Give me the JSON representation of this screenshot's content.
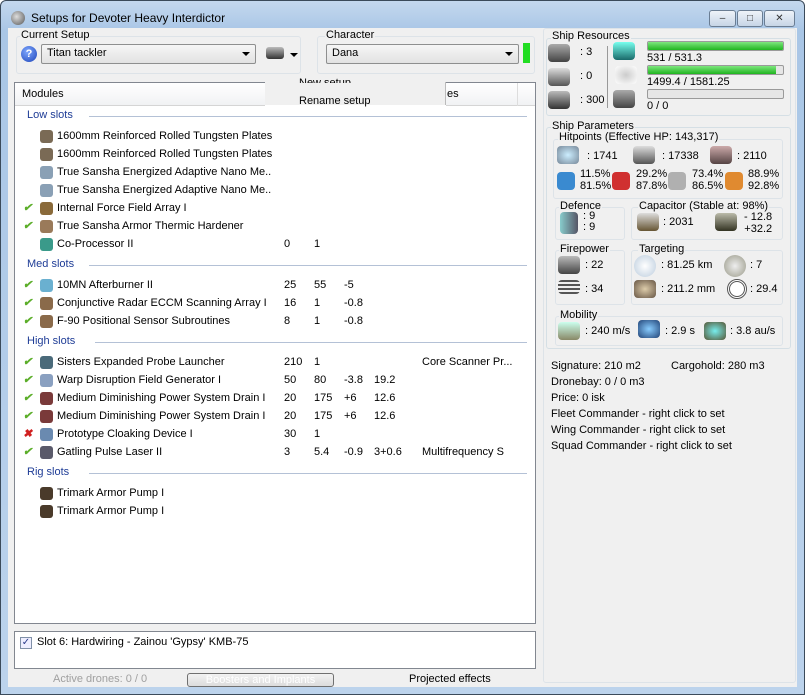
{
  "window": {
    "title": "Setups for Devoter Heavy Interdictor"
  },
  "setup": {
    "label": "Current Setup",
    "value": "Titan tackler"
  },
  "character": {
    "label": "Character",
    "value": "Dana",
    "status_color": "#22dd22"
  },
  "menu": {
    "items": [
      "New setup",
      "Rename setup"
    ]
  },
  "list": {
    "col_modules": "Modules",
    "col_partial": "es",
    "sections": [
      {
        "title": "Low slots",
        "rows": [
          {
            "name": "1600mm Reinforced Rolled Tungsten Plates",
            "state": "",
            "c": [
              "",
              "",
              "",
              "",
              ""
            ],
            "icon": "#7a6a55"
          },
          {
            "name": "1600mm Reinforced Rolled Tungsten Plates",
            "state": "",
            "c": [
              "",
              "",
              "",
              "",
              ""
            ],
            "icon": "#7a6a55"
          },
          {
            "name": "True Sansha Energized Adaptive Nano Me..",
            "state": "",
            "c": [
              "",
              "",
              "",
              "",
              ""
            ],
            "icon": "#8aa0b5"
          },
          {
            "name": "True Sansha Energized Adaptive Nano Me..",
            "state": "",
            "c": [
              "",
              "",
              "",
              "",
              ""
            ],
            "icon": "#8aa0b5"
          },
          {
            "name": "Internal Force Field Array I",
            "state": "ok",
            "c": [
              "",
              "",
              "",
              "",
              ""
            ],
            "icon": "#8a6a3a"
          },
          {
            "name": "True Sansha Armor Thermic Hardener",
            "state": "ok",
            "c": [
              "",
              "",
              "",
              "",
              ""
            ],
            "icon": "#9a7a5a"
          },
          {
            "name": "Co-Processor II",
            "state": "",
            "c": [
              "0",
              "1",
              "",
              "",
              ""
            ],
            "icon": "#3a9a8a"
          }
        ]
      },
      {
        "title": "Med slots",
        "rows": [
          {
            "name": "10MN Afterburner II",
            "state": "ok",
            "c": [
              "25",
              "55",
              "-5",
              "",
              ""
            ],
            "icon": "#6ab0d0"
          },
          {
            "name": "Conjunctive Radar ECCM Scanning Array I",
            "state": "ok",
            "c": [
              "16",
              "1",
              "-0.8",
              "",
              ""
            ],
            "icon": "#8a6a4a"
          },
          {
            "name": "F-90 Positional Sensor Subroutines",
            "state": "ok",
            "c": [
              "8",
              "1",
              "-0.8",
              "",
              ""
            ],
            "icon": "#8a6a4a"
          }
        ]
      },
      {
        "title": "High slots",
        "rows": [
          {
            "name": "Sisters Expanded Probe Launcher",
            "state": "ok",
            "c": [
              "210",
              "1",
              "",
              "",
              "Core Scanner Pr..."
            ],
            "icon": "#4a6a7a"
          },
          {
            "name": "Warp Disruption Field Generator I",
            "state": "ok",
            "c": [
              "50",
              "80",
              "-3.8",
              "19.2",
              ""
            ],
            "icon": "#8aa0c0"
          },
          {
            "name": "Medium Diminishing Power System Drain I",
            "state": "ok",
            "c": [
              "20",
              "175",
              "+6",
              "12.6",
              ""
            ],
            "icon": "#7a3a3a"
          },
          {
            "name": "Medium Diminishing Power System Drain I",
            "state": "ok",
            "c": [
              "20",
              "175",
              "+6",
              "12.6",
              ""
            ],
            "icon": "#7a3a3a"
          },
          {
            "name": "Prototype Cloaking Device I",
            "state": "bad",
            "c": [
              "30",
              "1",
              "",
              "",
              ""
            ],
            "icon": "#6a8ab0"
          },
          {
            "name": "Gatling Pulse Laser II",
            "state": "ok",
            "c": [
              "3",
              "5.4",
              "-0.9",
              "3+0.6",
              "Multifrequency S"
            ],
            "icon": "#5a5a6a"
          }
        ]
      },
      {
        "title": "Rig slots",
        "rows": [
          {
            "name": "Trimark Armor Pump I",
            "state": "",
            "c": [
              "",
              "",
              "",
              "",
              ""
            ],
            "icon": "#4a3a2a"
          },
          {
            "name": "Trimark Armor Pump I",
            "state": "",
            "c": [
              "",
              "",
              "",
              "",
              ""
            ],
            "icon": "#4a3a2a"
          }
        ]
      }
    ]
  },
  "implants": {
    "item": "Slot 6: Hardwiring - Zainou 'Gypsy' KMB-75",
    "checked": true
  },
  "footer": {
    "drones": "Active drones: 0 / 0",
    "boosters": "Boosters and Implants",
    "projected": "Projected effects"
  },
  "resources": {
    "title": "Ship Resources",
    "turrets": ": 3",
    "launchers": ": 0",
    "calibration": ": 300",
    "cpu": "531 / 531.3",
    "cpu_fraction": 1.0,
    "power": "1499.4 / 1581.25",
    "power_fraction": 0.948,
    "drone_bw": "0 / 0",
    "drone_fraction": 0
  },
  "params": {
    "title": "Ship Parameters",
    "hp_title": "Hitpoints (Effective HP: 143,317)",
    "shield": ": 1741",
    "armor": ": 17338",
    "structure": ": 2110",
    "res": [
      [
        "11.5%",
        "81.5%"
      ],
      [
        "29.2%",
        "87.8%"
      ],
      [
        "73.4%",
        "86.5%"
      ],
      [
        "88.9%",
        "92.8%"
      ]
    ],
    "defence_title": "Defence",
    "def1": ": 9",
    "def2": ": 9",
    "cap_title": "Capacitor (Stable at: 98%)",
    "cap": ": 2031",
    "cap_a": "- 12.8",
    "cap_b": "+32.2",
    "fire_title": "Firepower",
    "fire1": ": 22",
    "fire2": ": 34",
    "targ_title": "Targeting",
    "range": ": 81.25 km",
    "targets": ": 7",
    "scanres": ": 211.2 mm",
    "sensor": ": 29.4",
    "mob_title": "Mobility",
    "speed": ": 240 m/s",
    "align": ": 2.9 s",
    "warp": ": 3.8 au/s"
  },
  "info": {
    "signature": "Signature: 210 m2",
    "cargo": "Cargohold: 280 m3",
    "dronebay": "Dronebay: 0 / 0 m3",
    "price": "Price: 0 isk",
    "fleet": "Fleet Commander - right click to set",
    "wing": "Wing Commander - right click to set",
    "squad": "Squad Commander - right click to set"
  }
}
